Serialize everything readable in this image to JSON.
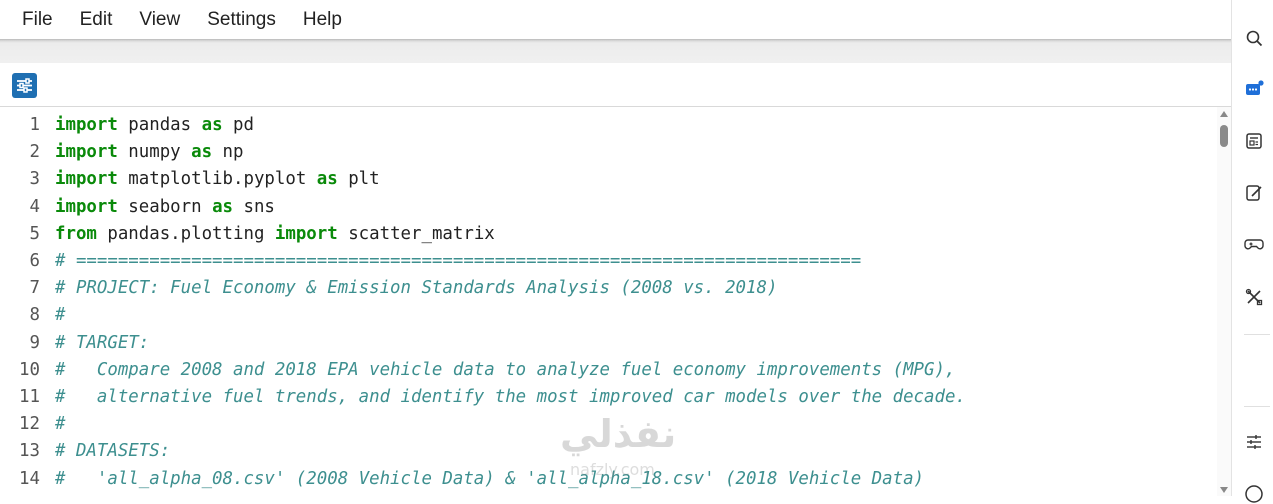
{
  "menu": {
    "file": "File",
    "edit": "Edit",
    "view": "View",
    "settings": "Settings",
    "help": "Help"
  },
  "editor": {
    "lines": [
      {
        "n": "1",
        "parts": [
          [
            "kw",
            "import"
          ],
          [
            "t",
            " pandas "
          ],
          [
            "kw",
            "as"
          ],
          [
            "t",
            " pd"
          ]
        ]
      },
      {
        "n": "2",
        "parts": [
          [
            "kw",
            "import"
          ],
          [
            "t",
            " numpy "
          ],
          [
            "kw",
            "as"
          ],
          [
            "t",
            " np"
          ]
        ]
      },
      {
        "n": "3",
        "parts": [
          [
            "kw",
            "import"
          ],
          [
            "t",
            " matplotlib.pyplot "
          ],
          [
            "kw",
            "as"
          ],
          [
            "t",
            " plt"
          ]
        ]
      },
      {
        "n": "4",
        "parts": [
          [
            "kw",
            "import"
          ],
          [
            "t",
            " seaborn "
          ],
          [
            "kw",
            "as"
          ],
          [
            "t",
            " sns"
          ]
        ]
      },
      {
        "n": "5",
        "parts": [
          [
            "kw",
            "from"
          ],
          [
            "t",
            " pandas.plotting "
          ],
          [
            "kw",
            "import"
          ],
          [
            "t",
            " scatter_matrix"
          ]
        ]
      },
      {
        "n": "6",
        "parts": [
          [
            "cm",
            "# ==========================================================================="
          ]
        ]
      },
      {
        "n": "7",
        "parts": [
          [
            "cm",
            "# PROJECT: Fuel Economy & Emission Standards Analysis (2008 vs. 2018)"
          ]
        ]
      },
      {
        "n": "8",
        "parts": [
          [
            "cm",
            "#"
          ]
        ]
      },
      {
        "n": "9",
        "parts": [
          [
            "cm",
            "# TARGET:"
          ]
        ]
      },
      {
        "n": "10",
        "parts": [
          [
            "cm",
            "#   Compare 2008 and 2018 EPA vehicle data to analyze fuel economy improvements (MPG),"
          ]
        ]
      },
      {
        "n": "11",
        "parts": [
          [
            "cm",
            "#   alternative fuel trends, and identify the most improved car models over the decade."
          ]
        ]
      },
      {
        "n": "12",
        "parts": [
          [
            "cm",
            "#"
          ]
        ]
      },
      {
        "n": "13",
        "parts": [
          [
            "cm",
            "# DATASETS:"
          ]
        ]
      },
      {
        "n": "14",
        "parts": [
          [
            "cm",
            "#   'all_alpha_08.csv' (2008 Vehicle Data) & 'all_alpha_18.csv' (2018 Vehicle Data)"
          ]
        ]
      }
    ]
  },
  "watermark": {
    "text": "نفذلي",
    "sub": "nafzly.com"
  },
  "icons": {
    "settings_button": "sliders-icon",
    "sidebar": [
      "search-icon",
      "chat-icon",
      "news-icon",
      "edit-icon",
      "gamepad-icon",
      "tools-icon",
      "adjust-icon",
      "help-icon"
    ]
  },
  "colors": {
    "keyword": "#0a8a0a",
    "comment": "#3d8f8f",
    "accent": "#1f6fb2"
  }
}
